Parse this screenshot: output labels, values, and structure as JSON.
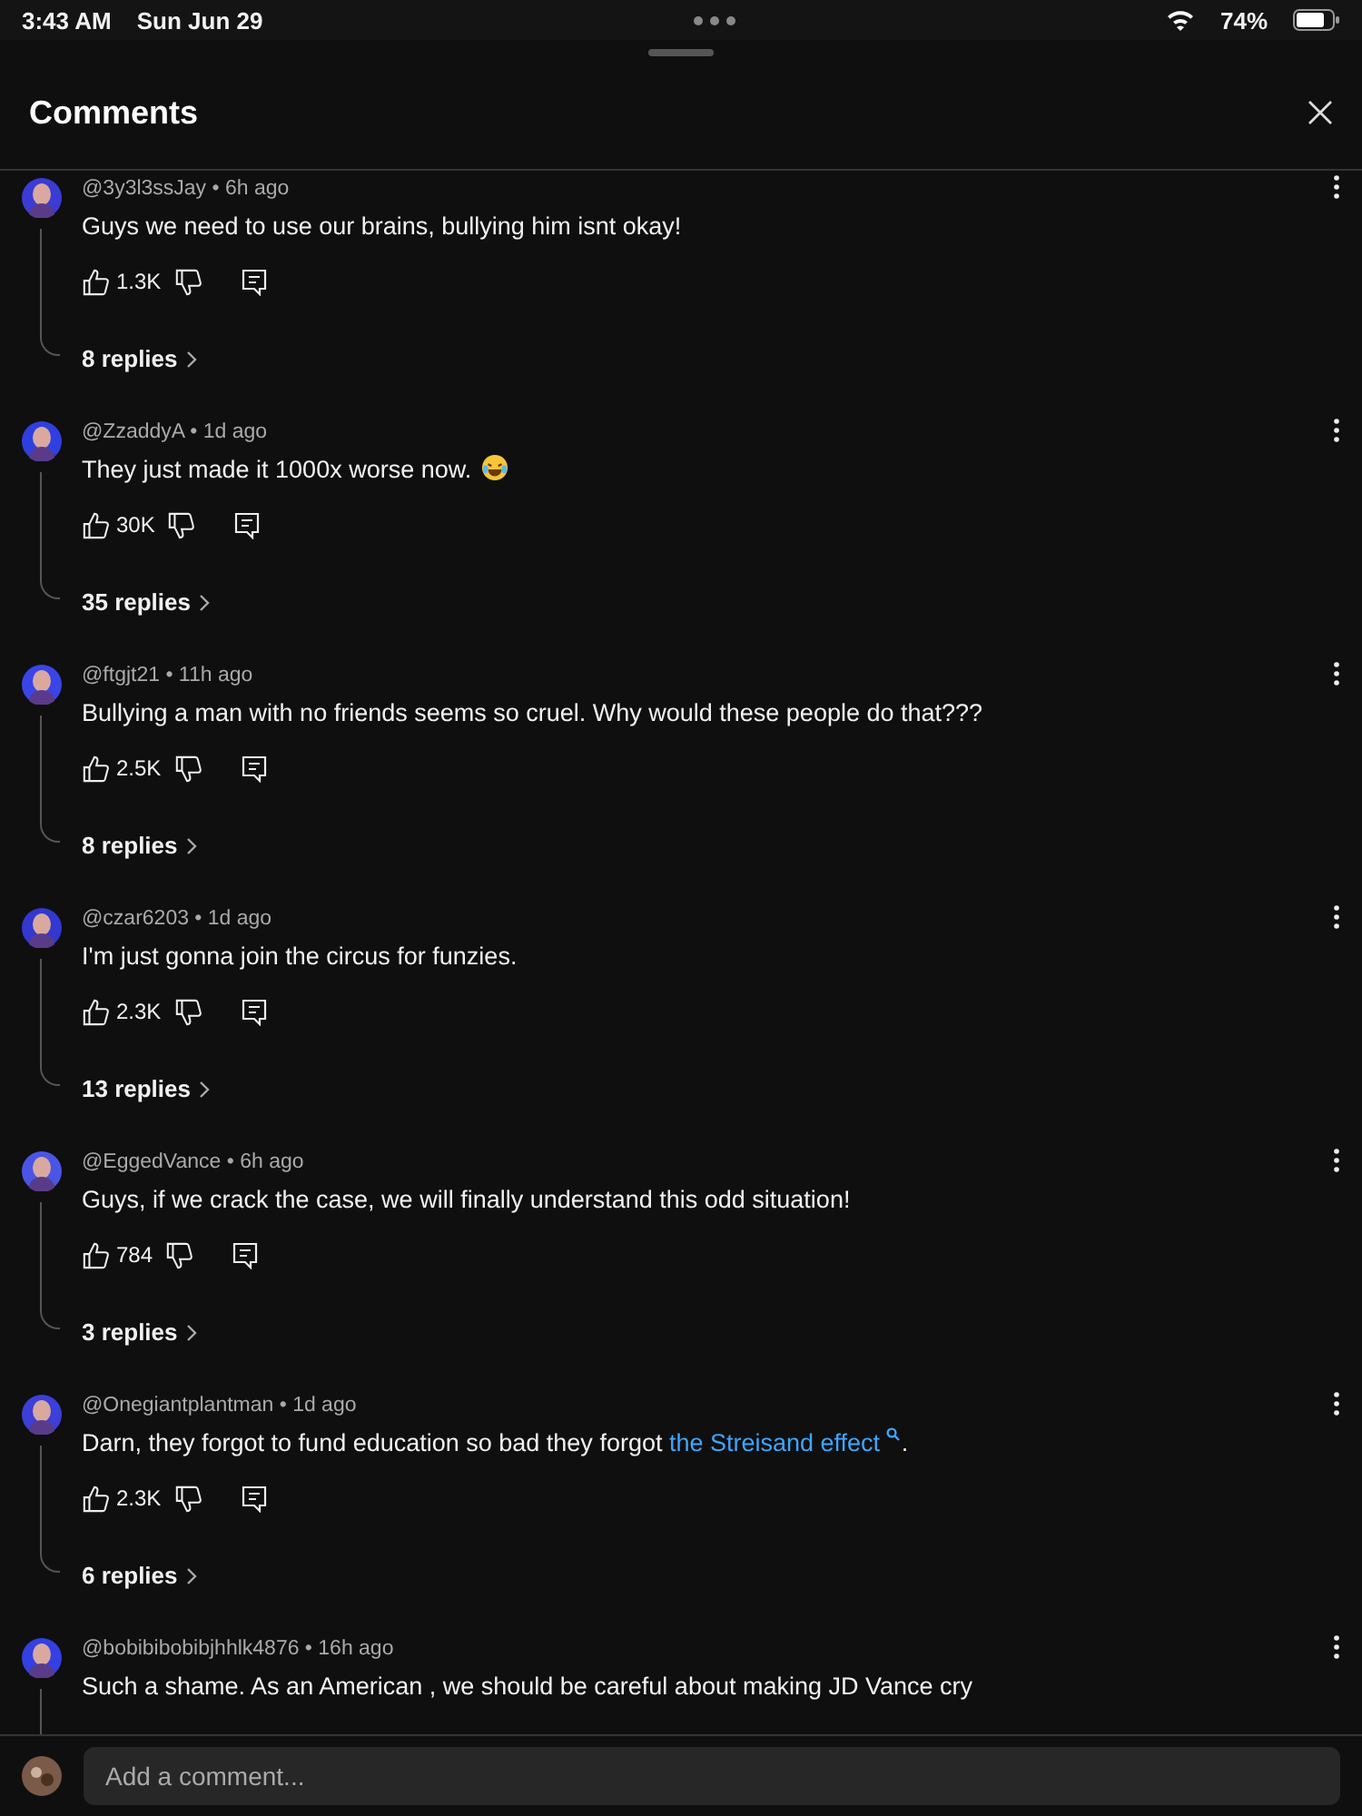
{
  "status_bar": {
    "time": "3:43 AM",
    "date": "Sun Jun 29",
    "battery": "74%"
  },
  "header": {
    "title": "Comments"
  },
  "comments": [
    {
      "meta": "@3y3l3ssJay • 6h ago",
      "text": [
        {
          "kind": "text",
          "value": "Guys we need to use our brains, bullying him isnt okay!"
        }
      ],
      "likes": "1.3K",
      "replies": "8 replies"
    },
    {
      "meta": "@ZzaddyA • 1d ago",
      "text": [
        {
          "kind": "text",
          "value": "They just made it 1000x worse now."
        },
        {
          "kind": "emoji"
        }
      ],
      "likes": "30K",
      "replies": "35 replies"
    },
    {
      "meta": "@ftgjt21 • 11h ago",
      "text": [
        {
          "kind": "text",
          "value": "Bullying a man with no friends seems so cruel. Why would these people do that???"
        }
      ],
      "likes": "2.5K",
      "replies": "8 replies"
    },
    {
      "meta": "@czar6203 • 1d ago",
      "text": [
        {
          "kind": "text",
          "value": "I'm just gonna join the circus for funzies."
        }
      ],
      "likes": "2.3K",
      "replies": "13 replies"
    },
    {
      "meta": "@EggedVance • 6h ago",
      "text": [
        {
          "kind": "text",
          "value": "Guys, if we crack the case, we will finally understand this odd situation!"
        }
      ],
      "likes": "784",
      "replies": "3 replies"
    },
    {
      "meta": "@Onegiantplantman • 1d ago",
      "text": [
        {
          "kind": "text",
          "value": "Darn, they forgot to fund education so bad they forgot "
        },
        {
          "kind": "link",
          "value": "the Streisand effect"
        },
        {
          "kind": "text",
          "value": "."
        }
      ],
      "likes": "2.3K",
      "replies": "6 replies"
    },
    {
      "meta": "@bobibibobibjhhlk4876 • 16h ago",
      "text": [
        {
          "kind": "text",
          "value": "Such a shame. As an American , we should be careful about making JD Vance cry"
        }
      ]
    }
  ],
  "composer": {
    "placeholder": "Add a comment..."
  }
}
